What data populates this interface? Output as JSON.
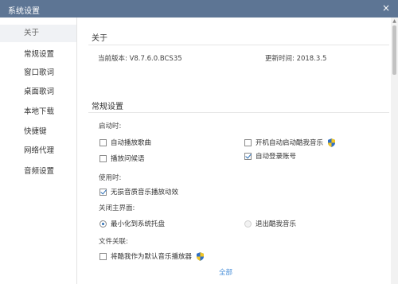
{
  "window": {
    "title": "系统设置",
    "close_glyph": "×"
  },
  "sidebar": {
    "items": [
      {
        "label": "关于",
        "active": true
      },
      {
        "label": "常规设置"
      },
      {
        "label": "窗口歌词"
      },
      {
        "label": "桌面歌词"
      },
      {
        "label": "本地下载"
      },
      {
        "label": "快捷键"
      },
      {
        "label": "网络代理"
      },
      {
        "label": "音频设置"
      }
    ]
  },
  "about": {
    "title": "关于",
    "version": "当前版本: V8.7.6.0.BCS35",
    "updated": "更新时间: 2018.3.5"
  },
  "general": {
    "title": "常规设置",
    "startup_label": "启动时:",
    "auto_play": {
      "label": "自动播放歌曲",
      "checked": false
    },
    "boot_start": {
      "label": "开机自动启动酷我音乐",
      "checked": false
    },
    "play_greeting": {
      "label": "播放问候语",
      "checked": false
    },
    "auto_login": {
      "label": "自动登录账号",
      "checked": true
    },
    "using_label": "使用时:",
    "lossless_anim": {
      "label": "无损音质音乐播放动效",
      "checked": true
    },
    "close_label": "关闭主界面:",
    "minimize_tray": {
      "label": "最小化到系统托盘",
      "checked": true
    },
    "exit_app": {
      "label": "退出酷我音乐",
      "checked": false
    },
    "file_assoc_label": "文件关联:",
    "default_player": {
      "label": "将酷我作为默认音乐播放器",
      "checked": false
    }
  },
  "footer": {
    "link": "全部"
  },
  "colors": {
    "titlebar": "#5d7594",
    "accent": "#2d6fb5",
    "link": "#4a90d9"
  },
  "icons": {
    "shield": "uac-shield-icon",
    "close": "close-icon"
  }
}
